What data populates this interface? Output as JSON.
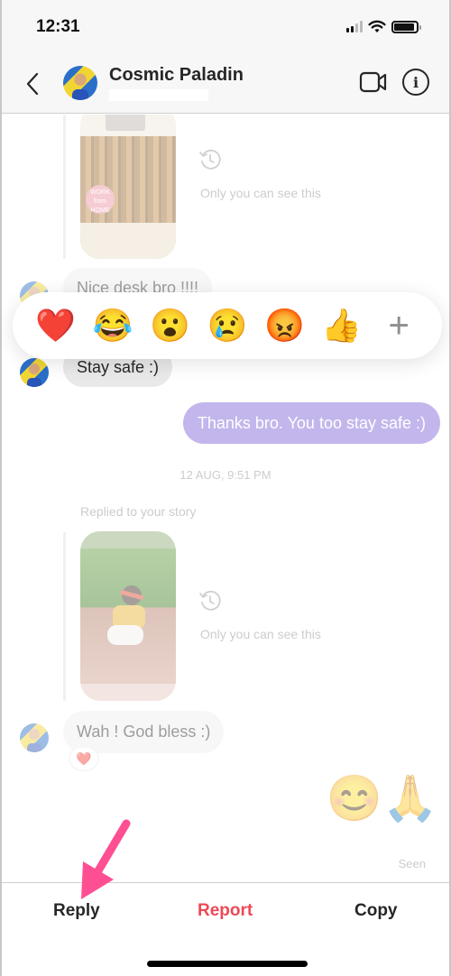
{
  "status_bar": {
    "time": "12:31",
    "signal_bars": 2,
    "battery_level": 0.9
  },
  "header": {
    "back_icon": "chevron-left-icon",
    "contact_name": "Cosmic Paladin",
    "video_icon": "video-camera-icon",
    "info_icon": "info-icon",
    "info_glyph": "i"
  },
  "messages": {
    "story_note_1": "Only you can see this",
    "sticker_text": "WORK from HOME",
    "incoming_1": "Nice desk bro !!!!",
    "incoming_2": "Stay safe :)",
    "outgoing_1": "Thanks bro. You too stay safe :)",
    "timestamp": "12 AUG, 9:51 PM",
    "replied_label": "Replied to your story",
    "story_note_2": "Only you can see this",
    "incoming_3": "Wah ! God bless :)",
    "incoming_3_reaction": "❤️",
    "outgoing_emojis": "😊🙏",
    "seen": "Seen"
  },
  "reaction_bar": {
    "reactions": [
      {
        "name": "heart",
        "glyph": "❤️"
      },
      {
        "name": "tears-of-joy",
        "glyph": "😂"
      },
      {
        "name": "surprised",
        "glyph": "😮"
      },
      {
        "name": "crying",
        "glyph": "😢"
      },
      {
        "name": "angry",
        "glyph": "😡"
      },
      {
        "name": "thumbs-up",
        "glyph": "👍"
      }
    ],
    "more": "+"
  },
  "actions": {
    "reply": "Reply",
    "report": "Report",
    "copy": "Copy"
  },
  "colors": {
    "outgoing_bubble": "#7b5fd6",
    "report": "#ed4956",
    "annotation_arrow": "#ff4f93"
  }
}
